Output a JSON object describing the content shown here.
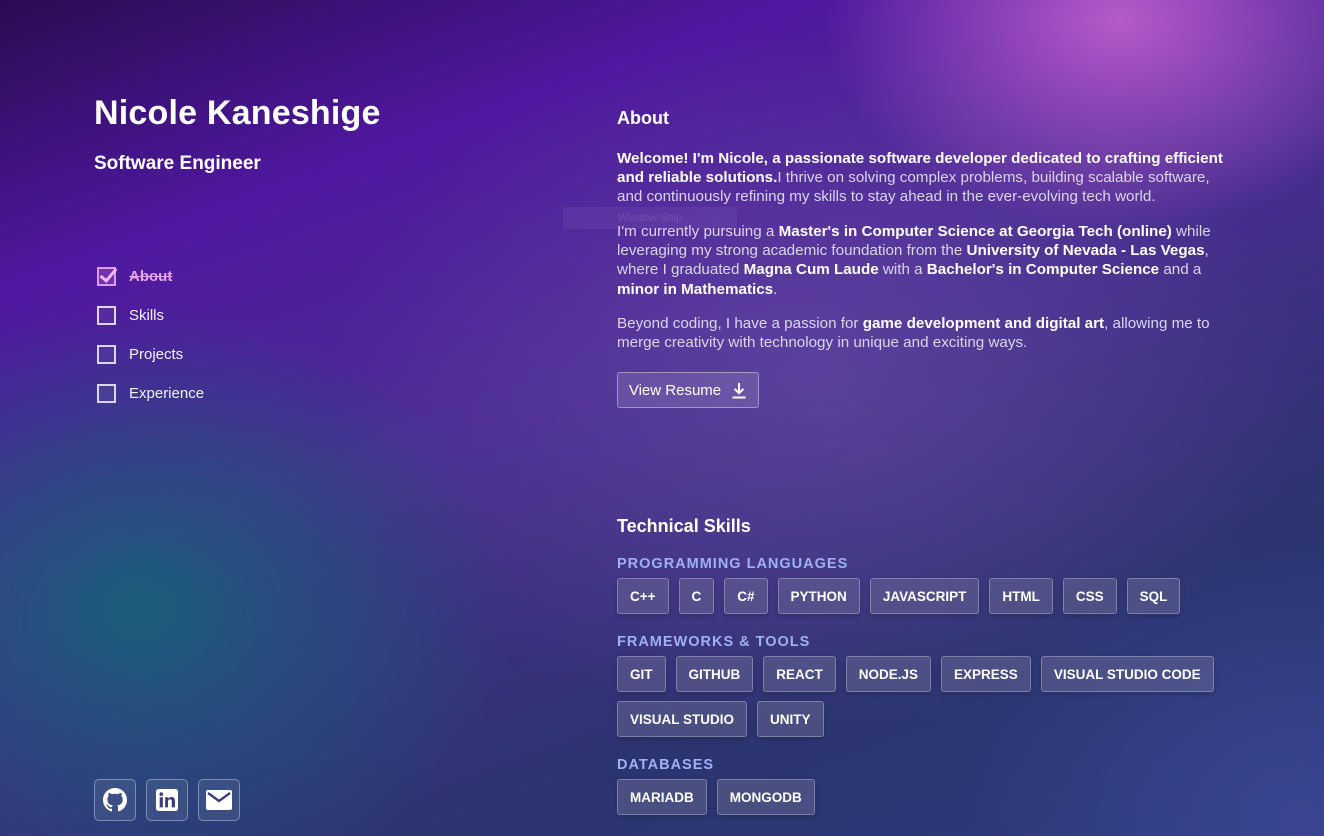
{
  "profile": {
    "name": "Nicole Kaneshige",
    "role": "Software Engineer"
  },
  "nav": [
    {
      "label": "About",
      "checked": true
    },
    {
      "label": "Skills",
      "checked": false
    },
    {
      "label": "Projects",
      "checked": false
    },
    {
      "label": "Experience",
      "checked": false
    }
  ],
  "overlay_text": "Window Snip",
  "socials": [
    {
      "icon": "github-icon"
    },
    {
      "icon": "linkedin-icon"
    },
    {
      "icon": "email-icon"
    }
  ],
  "about": {
    "title": "About",
    "p1_bold": "Welcome! I'm Nicole, a passionate software developer dedicated to crafting efficient and reliable solutions.",
    "p1_rest": "I thrive on solving complex problems, building scalable software, and continuously refining my skills to stay ahead in the ever-evolving tech world.",
    "p2": [
      {
        "t": "I'm currently pursuing a ",
        "b": false
      },
      {
        "t": "Master's in Computer Science at Georgia Tech (online)",
        "b": true
      },
      {
        "t": " while leveraging my strong academic foundation from the ",
        "b": false
      },
      {
        "t": "University of Nevada - Las Vegas",
        "b": true
      },
      {
        "t": ", where I graduated ",
        "b": false
      },
      {
        "t": "Magna Cum Laude",
        "b": true
      },
      {
        "t": " with a ",
        "b": false
      },
      {
        "t": "Bachelor's in Computer Science",
        "b": true
      },
      {
        "t": " and a ",
        "b": false
      },
      {
        "t": "minor in Mathematics",
        "b": true
      },
      {
        "t": ".",
        "b": false
      }
    ],
    "p3": [
      {
        "t": "Beyond coding, I have a passion for ",
        "b": false
      },
      {
        "t": "game development and digital art",
        "b": true
      },
      {
        "t": ", allowing me to merge creativity with technology in unique and exciting ways.",
        "b": false
      }
    ],
    "resume_label": "View Resume"
  },
  "skills": {
    "title": "Technical Skills",
    "categories": [
      {
        "title": "PROGRAMMING LANGUAGES",
        "items": [
          "C++",
          "C",
          "C#",
          "PYTHON",
          "JAVASCRIPT",
          "HTML",
          "CSS",
          "SQL"
        ]
      },
      {
        "title": "FRAMEWORKS & TOOLS",
        "items": [
          "GIT",
          "GITHUB",
          "REACT",
          "NODE.JS",
          "EXPRESS",
          "VISUAL STUDIO CODE",
          "VISUAL STUDIO",
          "UNITY"
        ]
      },
      {
        "title": "DATABASES",
        "items": [
          "MARIADB",
          "MONGODB"
        ]
      }
    ]
  },
  "colors": {
    "accent_check": "#e7a4ec",
    "category_title": "#9fb0f5"
  }
}
